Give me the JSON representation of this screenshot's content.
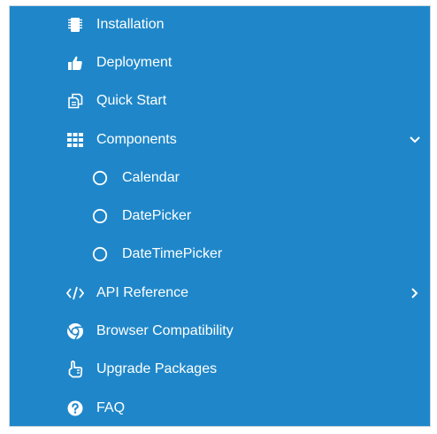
{
  "nav": {
    "items": [
      {
        "label": "Installation",
        "icon": "chip-icon"
      },
      {
        "label": "Deployment",
        "icon": "thumbs-up-icon"
      },
      {
        "label": "Quick Start",
        "icon": "copy-icon"
      },
      {
        "label": "Components",
        "icon": "grid-icon",
        "expanded": true
      },
      {
        "label": "Calendar",
        "icon": "circle-icon",
        "level": 2
      },
      {
        "label": "DatePicker",
        "icon": "circle-icon",
        "level": 2
      },
      {
        "label": "DateTimePicker",
        "icon": "circle-icon",
        "level": 2
      },
      {
        "label": "API Reference",
        "icon": "code-icon",
        "expandable": true
      },
      {
        "label": "Browser Compatibility",
        "icon": "chrome-icon"
      },
      {
        "label": "Upgrade Packages",
        "icon": "hand-icon"
      },
      {
        "label": "FAQ",
        "icon": "question-circle-icon"
      }
    ]
  },
  "colors": {
    "panel_background": "#1f87c9",
    "text": "#ffffff",
    "border": "#c9d6df"
  }
}
